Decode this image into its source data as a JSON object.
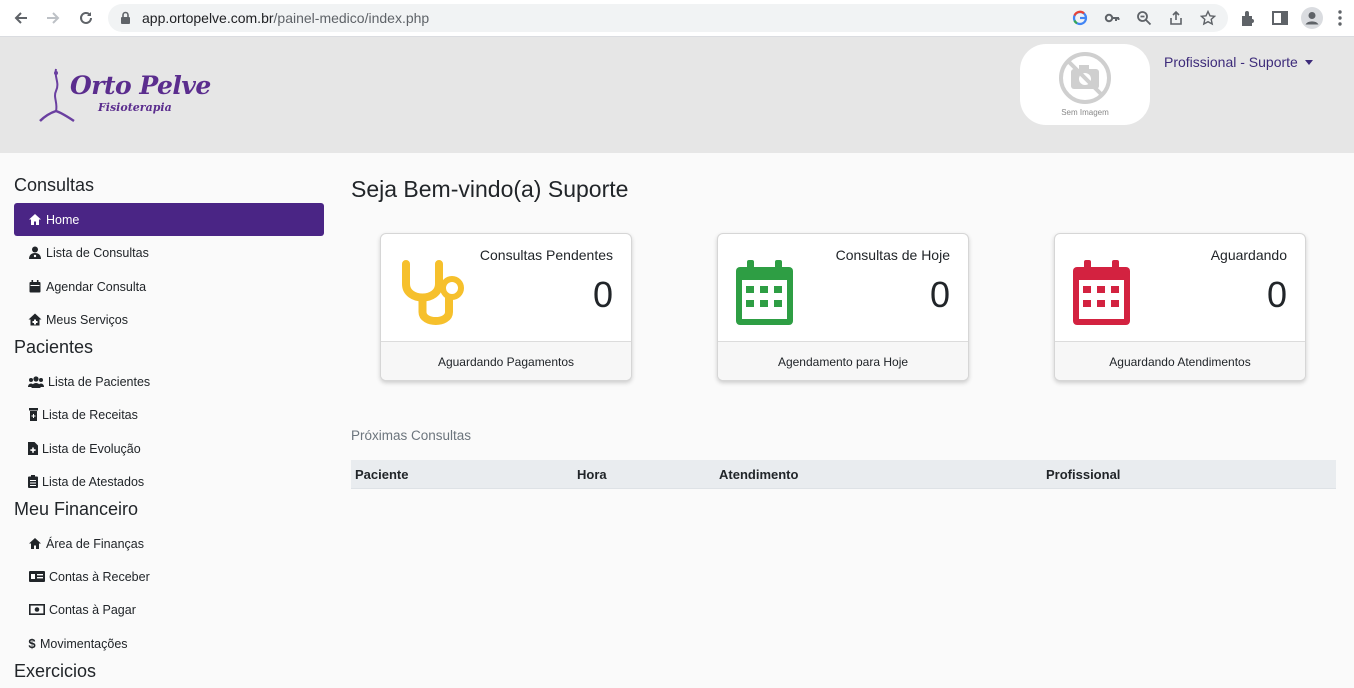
{
  "browser": {
    "url_host": "app.ortopelve.com.br",
    "url_path": "/painel-medico/index.php"
  },
  "header": {
    "logo_text": "Orto Pelve",
    "logo_sub": "Fisioterapia",
    "avatar_caption": "Sem Imagem",
    "user_menu_label": "Profissional - Suporte"
  },
  "sidebar": {
    "sections": [
      {
        "title": "Consultas"
      },
      {
        "title": "Pacientes"
      },
      {
        "title": "Meu Financeiro"
      },
      {
        "title": "Exercicios"
      }
    ],
    "items": [
      {
        "label": "Home",
        "icon": "home-icon"
      },
      {
        "label": "Lista de Consultas",
        "icon": "user-doctor-icon"
      },
      {
        "label": "Agendar Consulta",
        "icon": "calendar-icon"
      },
      {
        "label": "Meus Serviços",
        "icon": "house-medical-icon"
      },
      {
        "label": "Lista de Pacientes",
        "icon": "users-icon"
      },
      {
        "label": "Lista de Receitas",
        "icon": "prescription-bottle-icon"
      },
      {
        "label": "Lista de Evolução",
        "icon": "file-medical-icon"
      },
      {
        "label": "Lista de Atestados",
        "icon": "clipboard-icon"
      },
      {
        "label": "Área de Finanças",
        "icon": "home-icon"
      },
      {
        "label": "Contas à Receber",
        "icon": "money-check-icon"
      },
      {
        "label": "Contas à Pagar",
        "icon": "money-bill-icon"
      },
      {
        "label": "Movimentações",
        "icon": "dollar-icon"
      }
    ]
  },
  "main": {
    "welcome": "Seja Bem-vindo(a) Suporte",
    "cards": [
      {
        "title": "Consultas Pendentes",
        "value": "0",
        "footer": "Aguardando Pagamentos",
        "icon": "stethoscope-icon",
        "color": "#f6c02c"
      },
      {
        "title": "Consultas de Hoje",
        "value": "0",
        "footer": "Agendamento para Hoje",
        "icon": "calendar-icon",
        "color": "#2e9e44"
      },
      {
        "title": "Aguardando",
        "value": "0",
        "footer": "Aguardando Atendimentos",
        "icon": "calendar-icon",
        "color": "#d32240"
      }
    ],
    "next_title": "Próximas Consultas",
    "table_headers": [
      "Paciente",
      "Hora",
      "Atendimento",
      "Profissional"
    ]
  },
  "colors": {
    "brand_purple": "#4a2585",
    "header_bg": "#e6e6e6"
  }
}
